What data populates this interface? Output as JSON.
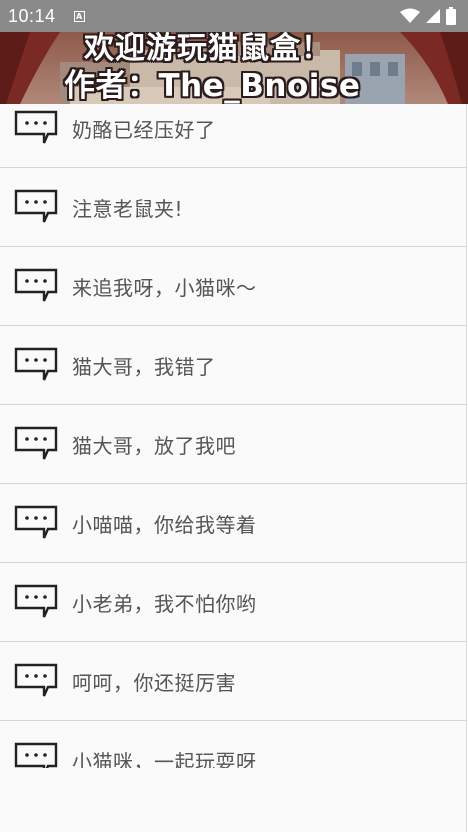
{
  "status_bar": {
    "time": "10:14",
    "notification_letter": "A",
    "icons": [
      "wifi-icon",
      "signal-icon",
      "battery-icon"
    ]
  },
  "banner": {
    "line1": "欢迎游玩猫鼠盒！",
    "line2": "作者：The_Bnoise"
  },
  "list": {
    "icon": "chat-bubble-icon",
    "items": [
      {
        "label": "奶酪已经压好了"
      },
      {
        "label": "注意老鼠夹!"
      },
      {
        "label": "来追我呀，小猫咪～"
      },
      {
        "label": "猫大哥，我错了"
      },
      {
        "label": "猫大哥，放了我吧"
      },
      {
        "label": "小喵喵，你给我等着"
      },
      {
        "label": "小老弟，我不怕你哟"
      },
      {
        "label": "呵呵，你还挺厉害"
      },
      {
        "label": "小猫咪，一起玩耍呀"
      }
    ]
  },
  "colors": {
    "status_bar_bg": "#8a8a8a",
    "list_bg": "#fafafa",
    "divider": "#d6d6d6",
    "label_text": "#555555",
    "icon_stroke": "#222222"
  }
}
